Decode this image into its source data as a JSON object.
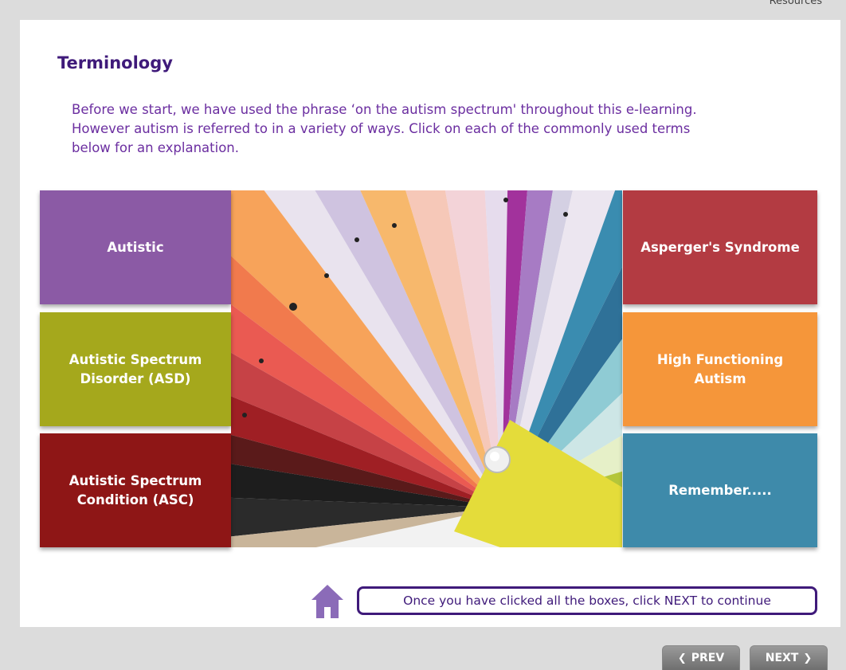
{
  "header": {
    "resources_label": "Resources"
  },
  "slide": {
    "title": "Terminology",
    "intro_lines": [
      "Before we start, we have used the phrase ‘on the autism spectrum' throughout this e-learning.",
      "However autism is referred to in a variety of ways.  Click on each of the commonly used terms",
      "below for an explanation."
    ],
    "tiles": {
      "autistic": {
        "label": "Autistic",
        "color": "#8b5aa5"
      },
      "asd": {
        "label": "Autistic Spectrum\nDisorder (ASD)",
        "color": "#a5a81c"
      },
      "asc": {
        "label": "Autistic Spectrum\nCondition (ASC)",
        "color": "#8e1616"
      },
      "aspergers": {
        "label": "Asperger's Syndrome",
        "color": "#b33b42"
      },
      "hfa": {
        "label": "High Functioning\nAutism",
        "color": "#f5963a"
      },
      "remember": {
        "label": "Remember.....",
        "color": "#3e8aaa"
      }
    },
    "instruction": "Once you have clicked all the boxes, click NEXT to continue"
  },
  "nav": {
    "prev_label": "PREV",
    "next_label": "NEXT",
    "prev_icon": "chevron-left-icon",
    "next_icon": "chevron-right-icon"
  },
  "icons": {
    "home": "home-icon"
  },
  "colors": {
    "accent": "#3f1a7a",
    "text": "#6b2ea0",
    "home_icon": "#8b6bb8"
  }
}
